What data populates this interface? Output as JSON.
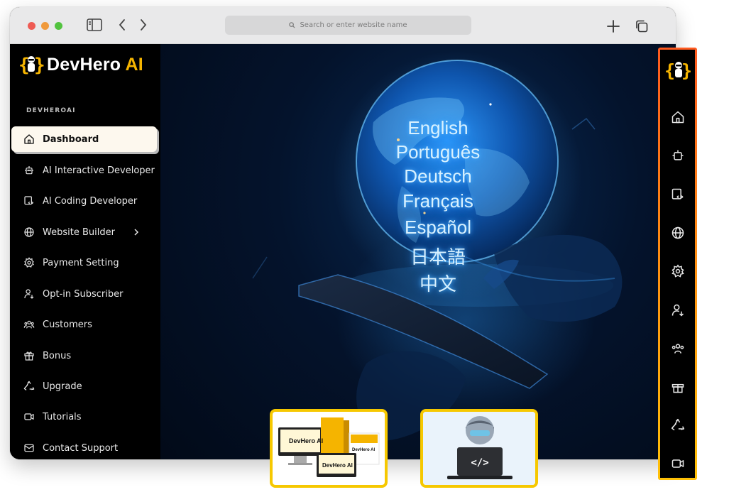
{
  "browser": {
    "address_placeholder": "Search or enter website name",
    "icons": [
      "sidebar-toggle-icon",
      "back-icon",
      "forward-icon",
      "search-icon",
      "new-tab-icon",
      "tabs-icon"
    ]
  },
  "app": {
    "logo_text_1": "DevHero",
    "logo_text_2": "AI",
    "section_label": "DEVHEROAI"
  },
  "sidebar": {
    "items": [
      {
        "label": "Dashboard",
        "icon": "home-icon",
        "active": true
      },
      {
        "label": "AI Interactive Developer",
        "icon": "robot-icon"
      },
      {
        "label": "AI Coding Developer",
        "icon": "code-file-icon"
      },
      {
        "label": "Website Builder",
        "icon": "globe-icon",
        "has_submenu": true
      },
      {
        "label": "Payment Setting",
        "icon": "gear-icon"
      },
      {
        "label": "Opt-in Subscriber",
        "icon": "user-download-icon"
      },
      {
        "label": "Customers",
        "icon": "users-icon"
      },
      {
        "label": "Bonus",
        "icon": "gift-icon"
      },
      {
        "label": "Upgrade",
        "icon": "recycle-icon"
      },
      {
        "label": "Tutorials",
        "icon": "video-icon"
      },
      {
        "label": "Contact Support",
        "icon": "mail-icon"
      }
    ]
  },
  "hero": {
    "languages": [
      "English",
      "Português",
      "Deutsch",
      "Français",
      "Español",
      "日本語",
      "中文"
    ]
  },
  "thumbnails": {
    "product_box_label": "DevHero AI",
    "product_box_alt": "DevHero AI"
  },
  "colors": {
    "accent_yellow": "#f5b400",
    "border_gradient_top": "#ff5a1f",
    "border_gradient_bottom": "#ffc107",
    "active_item_bg": "#fdf8ee"
  }
}
